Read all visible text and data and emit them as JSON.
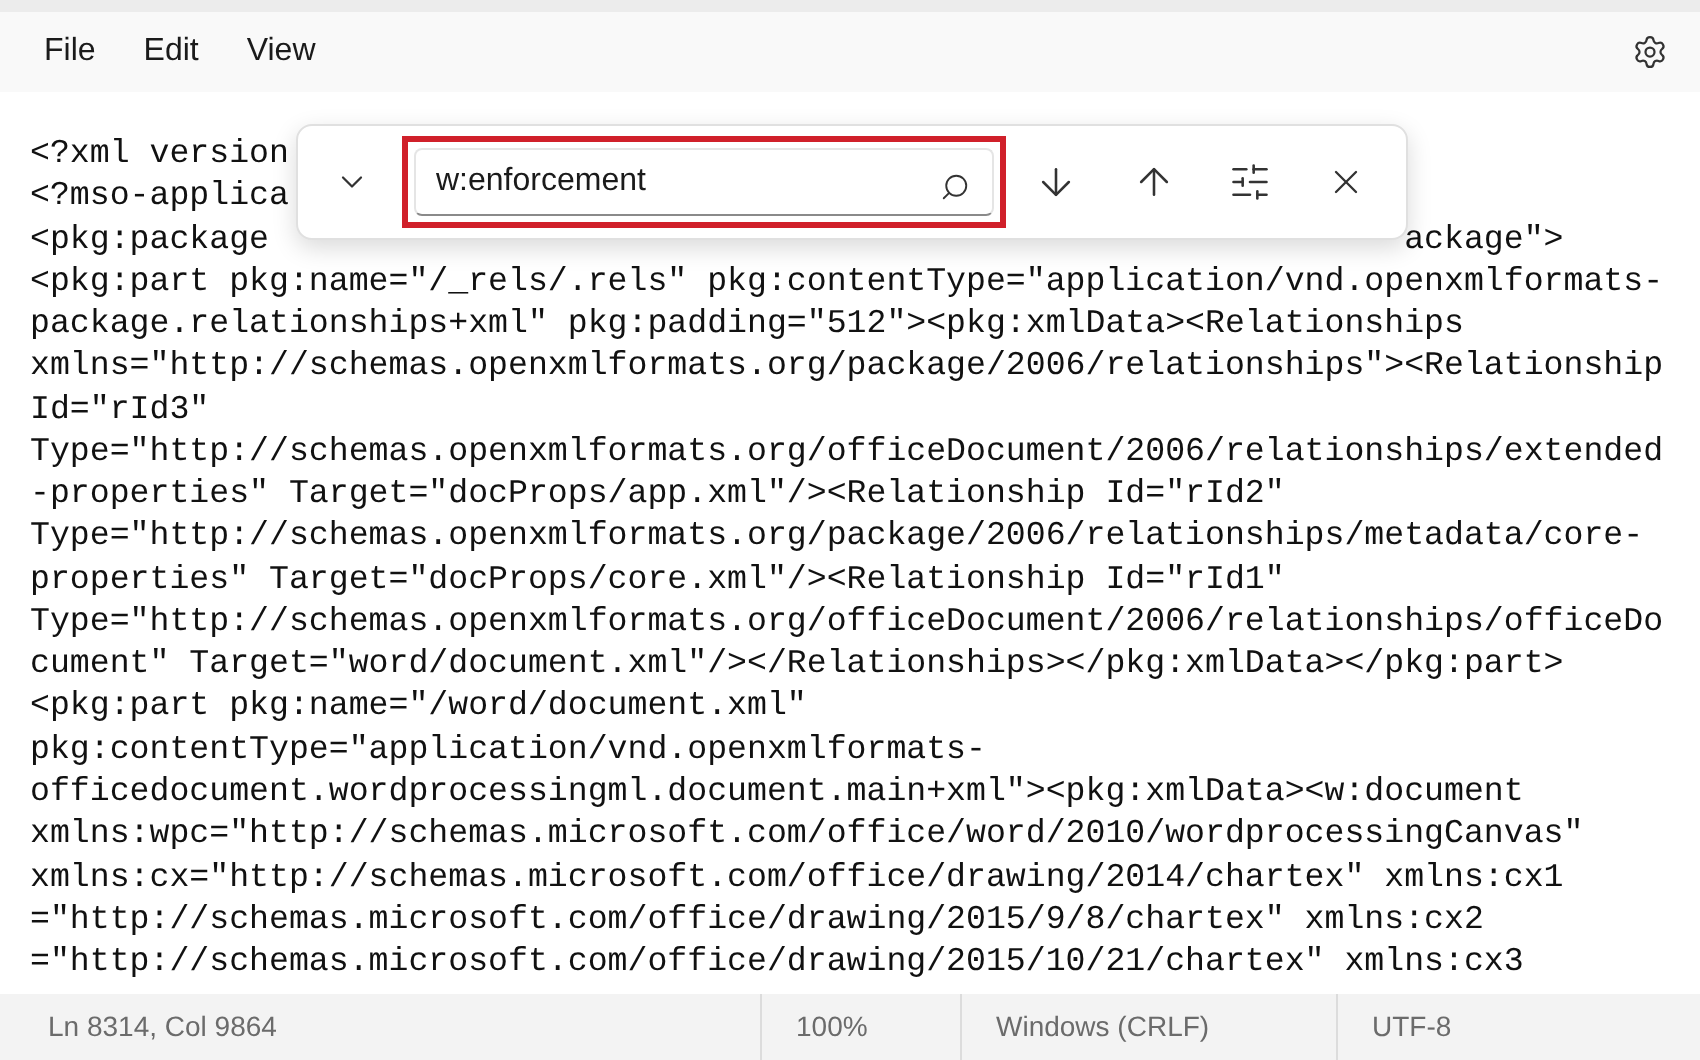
{
  "menu": [
    "File",
    "Edit",
    "View"
  ],
  "editor": {
    "lines": [
      "<?xml version",
      "<?mso-applica",
      [
        "<pkg:package",
        "ackage\">"
      ],
      "<pkg:part pkg:name=\"/_rels/.rels\" pkg:contentType=\"application/vnd.openxmlformats-",
      "package.relationships+xml\" pkg:padding=\"512\"><pkg:xmlData><Relationships",
      "xmlns=\"http://schemas.openxmlformats.org/package/2006/relationships\"><Relationship",
      "Id=\"rId3\"",
      "Type=\"http://schemas.openxmlformats.org/officeDocument/2006/relationships/extended",
      "-properties\" Target=\"docProps/app.xml\"/><Relationship Id=\"rId2\"",
      "Type=\"http://schemas.openxmlformats.org/package/2006/relationships/metadata/core-",
      "properties\" Target=\"docProps/core.xml\"/><Relationship Id=\"rId1\"",
      "Type=\"http://schemas.openxmlformats.org/officeDocument/2006/relationships/officeDo",
      "cument\" Target=\"word/document.xml\"/></Relationships></pkg:xmlData></pkg:part>",
      "<pkg:part pkg:name=\"/word/document.xml\"",
      "pkg:contentType=\"application/vnd.openxmlformats-",
      "officedocument.wordprocessingml.document.main+xml\"><pkg:xmlData><w:document",
      "xmlns:wpc=\"http://schemas.microsoft.com/office/word/2010/wordprocessingCanvas\"",
      "xmlns:cx=\"http://schemas.microsoft.com/office/drawing/2014/chartex\" xmlns:cx1",
      "=\"http://schemas.microsoft.com/office/drawing/2015/9/8/chartex\" xmlns:cx2",
      "=\"http://schemas.microsoft.com/office/drawing/2015/10/21/chartex\" xmlns:cx3"
    ]
  },
  "find": {
    "value": "w:enforcement",
    "highlighted": true
  },
  "status_bar": [
    "Ln 8314, Col 9864",
    "100%",
    "Windows (CRLF)",
    "UTF-8"
  ]
}
